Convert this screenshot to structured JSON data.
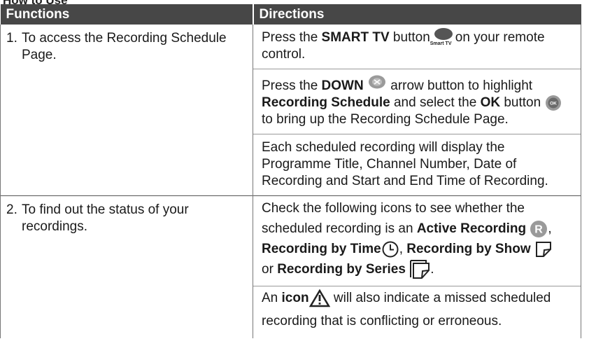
{
  "page_heading_partial": "How to Use",
  "table": {
    "header": {
      "functions": "Functions",
      "directions": "Directions"
    },
    "rows": [
      {
        "number": "1.",
        "function": "To access the Recording Schedule Page.",
        "directions": [
          {
            "t1": "Press the ",
            "b1": "SMART TV",
            "t2": " button",
            "smart_caption": "Smart TV",
            "t3": "on your remote control."
          },
          {
            "t1": "Press the ",
            "b1": "DOWN",
            "t2": " arrow button to highlight ",
            "b2": "Recording Schedule",
            "t3": " and select the ",
            "b3": "OK",
            "t4": " button",
            "ok_glyph": "OK",
            "t5": " to bring up the Recording Schedule Page."
          },
          {
            "text": "Each scheduled recording will display the Programme Title, Channel Number, Date of Recording and Start and End Time of Recording."
          }
        ]
      },
      {
        "number": "2.",
        "function": "To find out the status of your recordings.",
        "directions": [
          {
            "t1": "Check the following icons to see whether the scheduled recording is an ",
            "b1": "Active Recording",
            "active_glyph": "R",
            "t2": ", ",
            "b2": "Recording by Time",
            "t3": ", ",
            "b3": "Recording by Show",
            "t4": " or ",
            "b4": "Recording by Series",
            "t5": "."
          },
          {
            "t1": "An ",
            "b1": "icon",
            "t2": " will also indicate a missed scheduled recording that is conflicting or erroneous."
          }
        ]
      }
    ]
  },
  "colors": {
    "header_bg": "#474747",
    "header_text": "#ffffff",
    "icon_grey": "#9a9a9a"
  },
  "icons": [
    "smart-tv-button-icon",
    "down-arrow-button-icon",
    "ok-button-icon",
    "active-recording-icon",
    "clock-icon",
    "recording-by-show-icon",
    "recording-by-series-icon",
    "warning-icon"
  ]
}
